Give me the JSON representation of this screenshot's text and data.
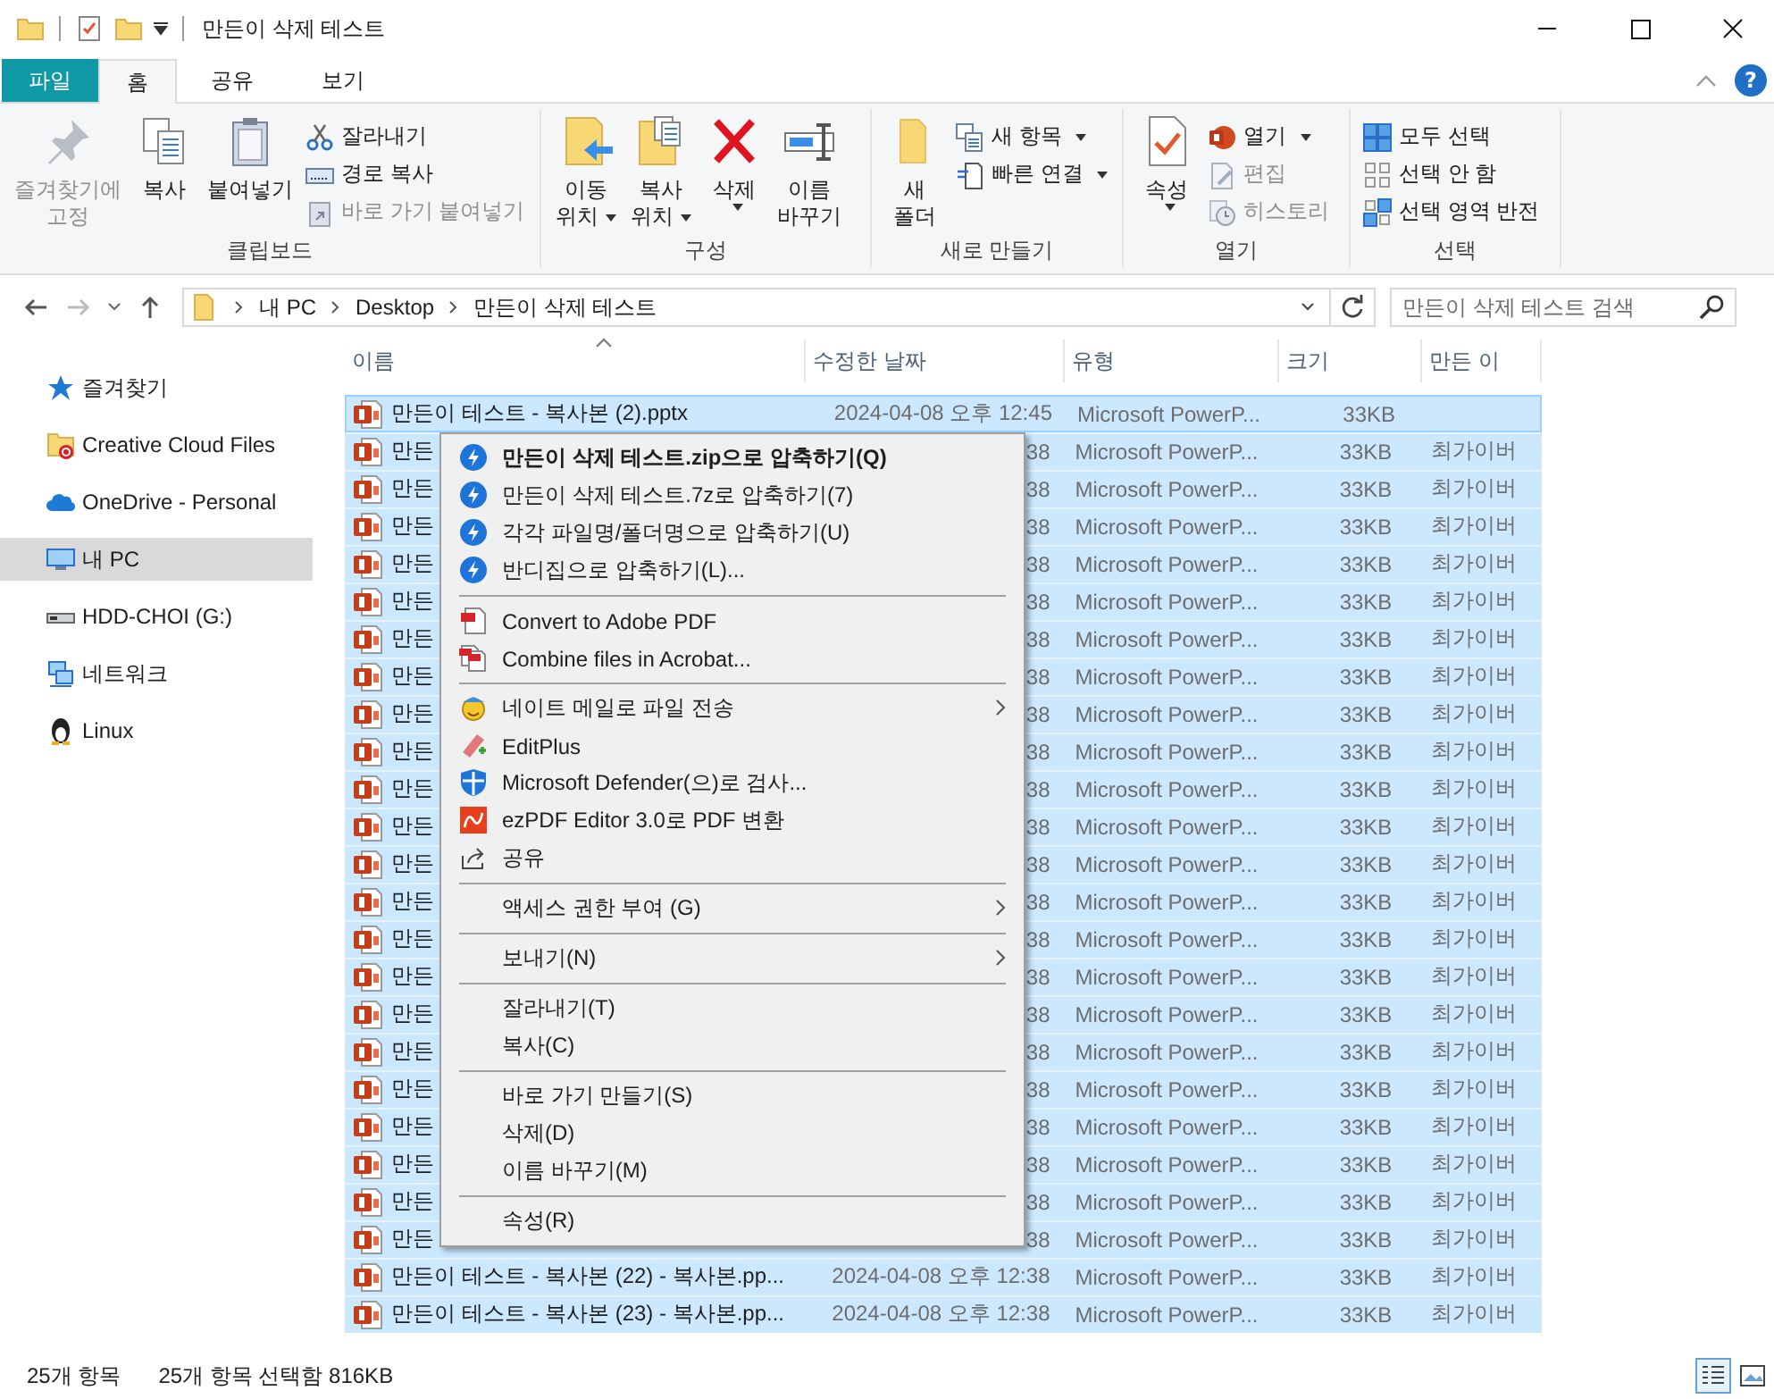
{
  "window": {
    "title": "만든이 삭제 테스트"
  },
  "ribbon": {
    "tabs": [
      {
        "label": "파일",
        "kind": "file",
        "selected": false
      },
      {
        "label": "홈",
        "kind": "tab",
        "selected": true
      },
      {
        "label": "공유",
        "kind": "tab",
        "selected": false
      },
      {
        "label": "보기",
        "kind": "tab",
        "selected": false
      }
    ],
    "help": "?",
    "groups": [
      {
        "label": "클립보드",
        "large": [
          {
            "lines": [
              "즐겨찾기에",
              "고정"
            ],
            "disabled": true,
            "dropdown": false
          },
          {
            "lines": [
              "복사"
            ],
            "disabled": false,
            "dropdown": false
          },
          {
            "lines": [
              "붙여넣기"
            ],
            "disabled": false,
            "dropdown": false
          }
        ],
        "small": [
          {
            "label": "잘라내기",
            "disabled": false,
            "dropdown": false
          },
          {
            "label": "경로 복사",
            "disabled": false,
            "dropdown": false
          },
          {
            "label": "바로 가기 붙여넣기",
            "disabled": true,
            "dropdown": false
          }
        ]
      },
      {
        "label": "구성",
        "large": [
          {
            "lines": [
              "이동",
              "위치"
            ],
            "disabled": false,
            "dropdown": true
          },
          {
            "lines": [
              "복사",
              "위치"
            ],
            "disabled": false,
            "dropdown": true
          },
          {
            "lines": [
              "삭제"
            ],
            "disabled": false,
            "dropdown": true
          },
          {
            "lines": [
              "이름",
              "바꾸기"
            ],
            "disabled": false,
            "dropdown": false
          }
        ]
      },
      {
        "label": "새로 만들기",
        "large": [
          {
            "lines": [
              "새",
              "폴더"
            ],
            "disabled": false,
            "dropdown": false
          }
        ],
        "small": [
          {
            "label": "새 항목",
            "disabled": false,
            "dropdown": true
          },
          {
            "label": "빠른 연결",
            "disabled": false,
            "dropdown": true
          }
        ]
      },
      {
        "label": "열기",
        "large": [
          {
            "lines": [
              "속성"
            ],
            "disabled": false,
            "dropdown": true
          }
        ],
        "small": [
          {
            "label": "열기",
            "disabled": false,
            "dropdown": true
          },
          {
            "label": "편집",
            "disabled": true,
            "dropdown": false
          },
          {
            "label": "히스토리",
            "disabled": true,
            "dropdown": false
          }
        ]
      },
      {
        "label": "선택",
        "small": [
          {
            "label": "모두 선택",
            "disabled": false,
            "dropdown": false
          },
          {
            "label": "선택 안 함",
            "disabled": false,
            "dropdown": false
          },
          {
            "label": "선택 영역 반전",
            "disabled": false,
            "dropdown": false
          }
        ]
      }
    ]
  },
  "address": {
    "crumbs": [
      "내 PC",
      "Desktop",
      "만든이 삭제 테스트"
    ],
    "search_placeholder": "만든이 삭제 테스트 검색"
  },
  "sidebar": {
    "items": [
      {
        "label": "즐겨찾기",
        "selected": false
      },
      {
        "label": "Creative Cloud Files",
        "selected": false
      },
      {
        "label": "OneDrive - Personal",
        "selected": false
      },
      {
        "label": "내 PC",
        "selected": true
      },
      {
        "label": "HDD-CHOI (G:)",
        "selected": false
      },
      {
        "label": "네트워크",
        "selected": false
      },
      {
        "label": "Linux",
        "selected": false
      }
    ]
  },
  "table": {
    "columns": [
      "이름",
      "수정한 날짜",
      "유형",
      "크기",
      "만든 이"
    ],
    "rows": [
      {
        "name": "만든이 테스트 - 복사본 (2).pptx",
        "date": "2024-04-08 오후 12:45",
        "type": "Microsoft PowerP...",
        "size": "33KB",
        "selected": true,
        "focused": true
      },
      {
        "name": "만든",
        "date": "38",
        "type": "Microsoft PowerP...",
        "size": "33KB",
        "author": "최가이버",
        "selected": true,
        "focused": false
      },
      {
        "name": "만든",
        "date": "38",
        "type": "Microsoft PowerP...",
        "size": "33KB",
        "author": "최가이버",
        "selected": true,
        "focused": false
      },
      {
        "name": "만든",
        "date": "38",
        "type": "Microsoft PowerP...",
        "size": "33KB",
        "author": "최가이버",
        "selected": true,
        "focused": false
      },
      {
        "name": "만든",
        "date": "38",
        "type": "Microsoft PowerP...",
        "size": "33KB",
        "author": "최가이버",
        "selected": true,
        "focused": false
      },
      {
        "name": "만든",
        "date": "38",
        "type": "Microsoft PowerP...",
        "size": "33KB",
        "author": "최가이버",
        "selected": true,
        "focused": false
      },
      {
        "name": "만든",
        "date": "38",
        "type": "Microsoft PowerP...",
        "size": "33KB",
        "author": "최가이버",
        "selected": true,
        "focused": false
      },
      {
        "name": "만든",
        "date": "38",
        "type": "Microsoft PowerP...",
        "size": "33KB",
        "author": "최가이버",
        "selected": true,
        "focused": false
      },
      {
        "name": "만든",
        "date": "38",
        "type": "Microsoft PowerP...",
        "size": "33KB",
        "author": "최가이버",
        "selected": true,
        "focused": false
      },
      {
        "name": "만든",
        "date": "38",
        "type": "Microsoft PowerP...",
        "size": "33KB",
        "author": "최가이버",
        "selected": true,
        "focused": false
      },
      {
        "name": "만든",
        "date": "38",
        "type": "Microsoft PowerP...",
        "size": "33KB",
        "author": "최가이버",
        "selected": true,
        "focused": false
      },
      {
        "name": "만든",
        "date": "38",
        "type": "Microsoft PowerP...",
        "size": "33KB",
        "author": "최가이버",
        "selected": true,
        "focused": false
      },
      {
        "name": "만든",
        "date": "38",
        "type": "Microsoft PowerP...",
        "size": "33KB",
        "author": "최가이버",
        "selected": true,
        "focused": false
      },
      {
        "name": "만든",
        "date": "38",
        "type": "Microsoft PowerP...",
        "size": "33KB",
        "author": "최가이버",
        "selected": true,
        "focused": false
      },
      {
        "name": "만든",
        "date": "38",
        "type": "Microsoft PowerP...",
        "size": "33KB",
        "author": "최가이버",
        "selected": true,
        "focused": false
      },
      {
        "name": "만든",
        "date": "38",
        "type": "Microsoft PowerP...",
        "size": "33KB",
        "author": "최가이버",
        "selected": true,
        "focused": false
      },
      {
        "name": "만든",
        "date": "38",
        "type": "Microsoft PowerP...",
        "size": "33KB",
        "author": "최가이버",
        "selected": true,
        "focused": false
      },
      {
        "name": "만든",
        "date": "38",
        "type": "Microsoft PowerP...",
        "size": "33KB",
        "author": "최가이버",
        "selected": true,
        "focused": false
      },
      {
        "name": "만든",
        "date": "38",
        "type": "Microsoft PowerP...",
        "size": "33KB",
        "author": "최가이버",
        "selected": true,
        "focused": false
      },
      {
        "name": "만든",
        "date": "38",
        "type": "Microsoft PowerP...",
        "size": "33KB",
        "author": "최가이버",
        "selected": true,
        "focused": false
      },
      {
        "name": "만든",
        "date": "38",
        "type": "Microsoft PowerP...",
        "size": "33KB",
        "author": "최가이버",
        "selected": true,
        "focused": false
      },
      {
        "name": "만든",
        "date": "38",
        "type": "Microsoft PowerP...",
        "size": "33KB",
        "author": "최가이버",
        "selected": true,
        "focused": false
      },
      {
        "name": "만든",
        "date": "38",
        "type": "Microsoft PowerP...",
        "size": "33KB",
        "author": "최가이버",
        "selected": true,
        "focused": false
      },
      {
        "name": "만든이 테스트 - 복사본 (22) - 복사본.pp...",
        "date": "2024-04-08 오후 12:38",
        "type": "Microsoft PowerP...",
        "size": "33KB",
        "author": "최가이버",
        "selected": true,
        "focused": false
      },
      {
        "name": "만든이 테스트 - 복사본 (23) - 복사본.pp...",
        "date": "2024-04-08 오후 12:38",
        "type": "Microsoft PowerP...",
        "size": "33KB",
        "author": "최가이버",
        "selected": true,
        "focused": false
      }
    ]
  },
  "context_menu": [
    {
      "kind": "item",
      "label": "만든이 삭제 테스트.zip으로 압축하기(Q)",
      "default": true,
      "submenu": false
    },
    {
      "kind": "item",
      "label": "만든이 삭제 테스트.7z로 압축하기(7)",
      "default": false,
      "submenu": false
    },
    {
      "kind": "item",
      "label": "각각 파일명/폴더명으로 압축하기(U)",
      "default": false,
      "submenu": false
    },
    {
      "kind": "item",
      "label": "반디집으로 압축하기(L)...",
      "default": false,
      "submenu": false
    },
    {
      "kind": "separator"
    },
    {
      "kind": "item",
      "label": "Convert to Adobe PDF",
      "default": false,
      "submenu": false
    },
    {
      "kind": "item",
      "label": "Combine files in Acrobat...",
      "default": false,
      "submenu": false
    },
    {
      "kind": "separator"
    },
    {
      "kind": "item",
      "label": "네이트 메일로 파일 전송",
      "default": false,
      "submenu": true
    },
    {
      "kind": "item",
      "label": "EditPlus",
      "default": false,
      "submenu": false
    },
    {
      "kind": "item",
      "label": "Microsoft Defender(으)로 검사...",
      "default": false,
      "submenu": false
    },
    {
      "kind": "item",
      "label": "ezPDF Editor 3.0로 PDF 변환",
      "default": false,
      "submenu": false
    },
    {
      "kind": "item",
      "label": "공유",
      "default": false,
      "submenu": false
    },
    {
      "kind": "separator"
    },
    {
      "kind": "item",
      "label": "액세스 권한 부여 (G)",
      "default": false,
      "submenu": true
    },
    {
      "kind": "separator"
    },
    {
      "kind": "item",
      "label": "보내기(N)",
      "default": false,
      "submenu": true
    },
    {
      "kind": "separator"
    },
    {
      "kind": "item",
      "label": "잘라내기(T)",
      "default": false,
      "submenu": false
    },
    {
      "kind": "item",
      "label": "복사(C)",
      "default": false,
      "submenu": false
    },
    {
      "kind": "separator"
    },
    {
      "kind": "item",
      "label": "바로 가기 만들기(S)",
      "default": false,
      "submenu": false
    },
    {
      "kind": "item",
      "label": "삭제(D)",
      "default": false,
      "submenu": false
    },
    {
      "kind": "item",
      "label": "이름 바꾸기(M)",
      "default": false,
      "submenu": false
    },
    {
      "kind": "separator"
    },
    {
      "kind": "item",
      "label": "속성(R)",
      "default": false,
      "submenu": false
    }
  ],
  "status_bar": {
    "item_count": "25개 항목",
    "selection": "25개 항목 선택함 816KB",
    "views": [
      {
        "kind": "details",
        "selected": true
      },
      {
        "kind": "tiles",
        "selected": false
      }
    ]
  }
}
